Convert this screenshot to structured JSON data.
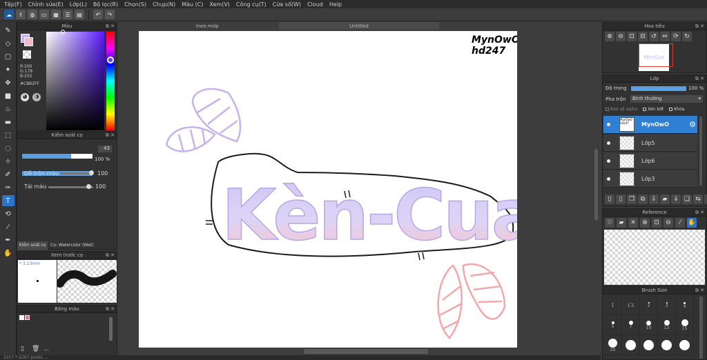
{
  "menu": [
    "Tệp(F)",
    "Chỉnh sửa(E)",
    "Lớp(L)",
    "Bộ lọc(R)",
    "Chọn(S)",
    "Chụp(N)",
    "Màu (C)",
    "Xem(V)",
    "Công cụ(T)",
    "Cửa sổ(W)",
    "Cloud",
    "Help"
  ],
  "tabs": {
    "doc1": "mee.mdp",
    "doc2": "Untitled"
  },
  "color_panel": {
    "title": "Màu",
    "r": "R:200",
    "g": "G:178",
    "b": "B:255",
    "hex": "#C8B2FF",
    "fg_color": "#c8b2ff",
    "bg_color": "#f7b8cc"
  },
  "brush_control": {
    "title": "Kiểm soát cọ",
    "size_value": "43",
    "opacity_value": "100 %",
    "blend_label": "Dễ trộn màu",
    "blend_value": "100",
    "color_amount_label": "Tải màu",
    "color_amount_value": "100",
    "tab_active": "Kiểm soát cọ",
    "tab_other": "Cọ: Watercolor (Wet)"
  },
  "brush_preview": {
    "title": "Xem trước cọ",
    "size": "* 3.13mm"
  },
  "palette": {
    "title": "Bảng màu",
    "more": "..."
  },
  "artwork": {
    "signature_line1": "MynOwO",
    "signature_line2": "hd247",
    "main_text": "Kèn-Cua"
  },
  "navigator": {
    "title": "Hoa tiêu",
    "thumb_text": "Kèn-Cua"
  },
  "layer_panel": {
    "title": "Lớp",
    "opacity_label": "Độ trong",
    "opacity_value": "100 %",
    "blend_label": "Pha trộn",
    "blend_mode": "Bình thường",
    "protect_alpha": "Bảo vệ alpha",
    "clipping": "Xén bớt",
    "lock": "Khóa",
    "layers": [
      {
        "name": "MynOwO",
        "thumb": "MynOwO hd247"
      },
      {
        "name": "Lớp5"
      },
      {
        "name": "Lớp6"
      },
      {
        "name": "Lớp3"
      }
    ]
  },
  "reference": {
    "title": "Reference"
  },
  "brush_size": {
    "title": "Brush Size",
    "sizes": [
      "1",
      "1.5",
      "2",
      "3",
      "4",
      "5",
      "7",
      "10",
      "12",
      "15",
      "20",
      "",
      "",
      "",
      "",
      ""
    ]
  },
  "status": "2217 * 2267 pixels ..."
}
